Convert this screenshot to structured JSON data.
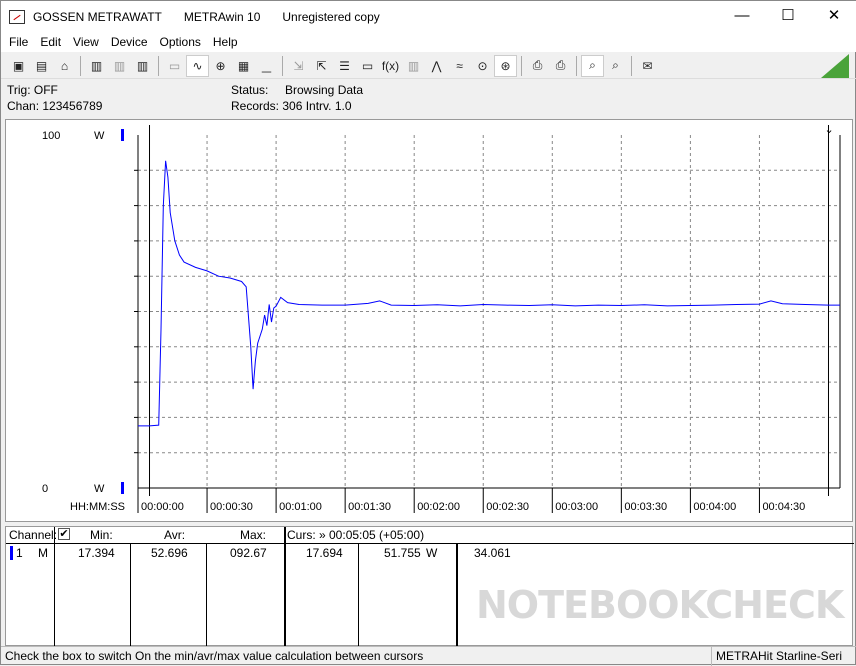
{
  "window": {
    "title_parts": [
      "GOSSEN METRAWATT",
      "METRAwin 10",
      "Unregistered copy"
    ],
    "minimize": "—",
    "maximize": "☐",
    "close": "✕"
  },
  "menu": [
    "File",
    "Edit",
    "View",
    "Device",
    "Options",
    "Help"
  ],
  "toolbar": [
    {
      "icon": "save-icon",
      "glyph": "▣"
    },
    {
      "icon": "save-as-icon",
      "glyph": "▤"
    },
    {
      "icon": "open-folder-icon",
      "glyph": "⌂"
    },
    {
      "sep": true
    },
    {
      "icon": "device-read-icon",
      "glyph": "▥"
    },
    {
      "icon": "device-disabled-icon",
      "glyph": "▥",
      "disabled": true
    },
    {
      "icon": "memory-icon",
      "glyph": "▥"
    },
    {
      "sep": true
    },
    {
      "icon": "digital-display-icon",
      "glyph": "▭",
      "disabled": true
    },
    {
      "icon": "line-chart-icon",
      "glyph": "∿",
      "active": true
    },
    {
      "icon": "crosshair-icon",
      "glyph": "⊕"
    },
    {
      "icon": "table-icon",
      "glyph": "▦"
    },
    {
      "icon": "histogram-icon",
      "glyph": "▁",
      "disabled": true
    },
    {
      "sep": true
    },
    {
      "icon": "export-icon",
      "glyph": "⇲",
      "disabled": true
    },
    {
      "icon": "import-icon",
      "glyph": "⇱"
    },
    {
      "icon": "list-icon",
      "glyph": "☰"
    },
    {
      "icon": "monitor-icon",
      "glyph": "▭"
    },
    {
      "icon": "function-icon",
      "glyph": "f(x)"
    },
    {
      "icon": "device-settings-icon",
      "glyph": "▥",
      "disabled": true
    },
    {
      "icon": "trigger-icon",
      "glyph": "⋀"
    },
    {
      "icon": "wave-icon",
      "glyph": "≈"
    },
    {
      "icon": "zoom-fit-icon",
      "glyph": "⊙"
    },
    {
      "icon": "zoom-active-icon",
      "glyph": "⊛",
      "active": true
    },
    {
      "sep": true
    },
    {
      "icon": "print-icon",
      "glyph": "⎙"
    },
    {
      "icon": "print-preview-icon",
      "glyph": "⎙"
    },
    {
      "sep": true
    },
    {
      "icon": "zoom-in-icon",
      "glyph": "⌕",
      "active": true
    },
    {
      "icon": "zoom-out-icon",
      "glyph": "⌕"
    },
    {
      "sep": true
    },
    {
      "icon": "comment-icon",
      "glyph": "✉"
    }
  ],
  "info": {
    "trig": "Trig: OFF",
    "chan": "Chan:  123456789",
    "status_label": "Status:",
    "status_value": "Browsing Data",
    "records": "Records: 306  Intrv. 1.0"
  },
  "chart_data": {
    "type": "line",
    "y_top_label": "100",
    "y_bottom_label": "0",
    "unit": "W",
    "ylim": [
      0,
      100
    ],
    "xlabel": "HH:MM:SS",
    "xlim": [
      0,
      305
    ],
    "x_ticks": [
      {
        "t": 0,
        "label": "00:00:00"
      },
      {
        "t": 30,
        "label": "00:00:30"
      },
      {
        "t": 60,
        "label": "00:01:00"
      },
      {
        "t": 90,
        "label": "00:01:30"
      },
      {
        "t": 120,
        "label": "00:02:00"
      },
      {
        "t": 150,
        "label": "00:02:30"
      },
      {
        "t": 180,
        "label": "00:03:00"
      },
      {
        "t": 210,
        "label": "00:03:30"
      },
      {
        "t": 240,
        "label": "00:04:00"
      },
      {
        "t": 270,
        "label": "00:04:30"
      }
    ],
    "grid": true,
    "line_color": "#0000ff",
    "cursor_t": [
      5,
      300
    ],
    "series": [
      {
        "x": [
          0,
          5,
          9,
          10,
          11,
          12,
          13,
          14,
          16,
          18,
          20,
          25,
          30,
          35,
          40,
          45,
          47,
          49,
          50,
          51,
          52,
          54,
          55,
          56,
          57,
          58,
          59,
          60,
          62,
          65,
          70,
          80,
          90,
          100,
          105,
          110,
          120,
          130,
          140,
          150,
          160,
          170,
          180,
          190,
          200,
          210,
          220,
          230,
          240,
          250,
          260,
          270,
          275,
          280,
          290,
          300,
          305
        ],
        "y": [
          17.6,
          17.6,
          17.8,
          45,
          80,
          92.7,
          88,
          78,
          70,
          66,
          64,
          62.5,
          61.5,
          60,
          59.5,
          58.5,
          57,
          40,
          28,
          36,
          41,
          45,
          49,
          46,
          52,
          47,
          51,
          51.5,
          54,
          52.5,
          52,
          51.8,
          51.8,
          52.3,
          53,
          51.8,
          51.7,
          51.9,
          51.6,
          52,
          51.8,
          51.7,
          51.9,
          51.6,
          51.8,
          51.7,
          51.9,
          51.6,
          51.7,
          51.8,
          52,
          52.1,
          53,
          52.2,
          52,
          51.8,
          51.8
        ]
      }
    ]
  },
  "table": {
    "channel_h": "Channel:",
    "checked": true,
    "min_h": "Min:",
    "avr_h": "Avr:",
    "max_h": "Max:",
    "curs_h": "Curs: » 00:05:05 (+05:00)",
    "row": {
      "ch": "1",
      "mode": "M",
      "min": "17.394",
      "avr": "52.696",
      "max": "092.67",
      "c1": "17.694",
      "c2": "51.755",
      "unit": "W",
      "c3": "34.061"
    },
    "channel_color": "#0000ff"
  },
  "watermark": "NOTEBOOKCHECK",
  "status": {
    "hint": "Check the box to switch On the min/avr/max value calculation between cursors",
    "device": "METRAHit Starline-Seri"
  }
}
